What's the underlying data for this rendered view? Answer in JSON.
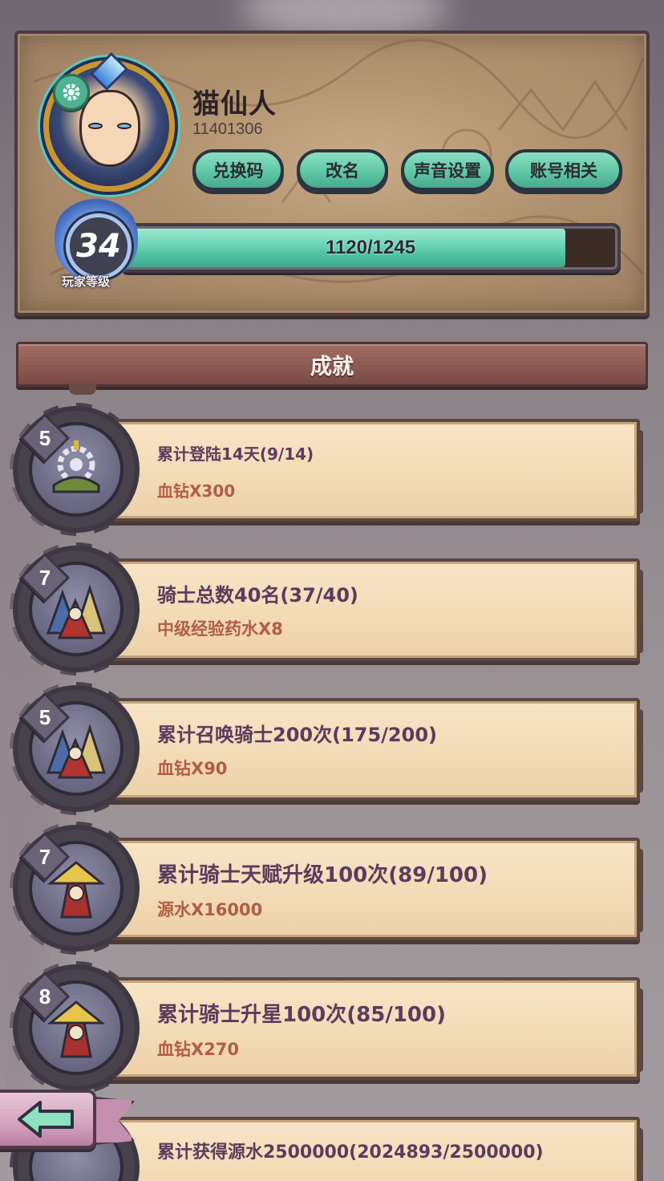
{
  "player": {
    "name": "猫仙人",
    "id": "11401306",
    "level": "34",
    "level_label": "玩家等级",
    "xp_text": "1120/1245",
    "xp_fraction": 0.8996
  },
  "buttons": {
    "redeem": "兑换码",
    "rename": "改名",
    "sound": "声音设置",
    "account": "账号相关"
  },
  "section_title": "成就",
  "achievements": [
    {
      "level": "5",
      "title": "累计登陆14天(9/14)",
      "reward": "血钻X300",
      "icon": "helmet-gear-icon"
    },
    {
      "level": "7",
      "title": "骑士总数40名(37/40)",
      "reward": "中级经验药水X8",
      "icon": "knights-group-icon"
    },
    {
      "level": "5",
      "title": "累计召唤骑士200次(175/200)",
      "reward": "血钻X90",
      "icon": "knights-group-icon"
    },
    {
      "level": "7",
      "title": "累计骑士天赋升级100次(89/100)",
      "reward": "源水X16000",
      "icon": "hooded-knight-icon"
    },
    {
      "level": "8",
      "title": "累计骑士升星100次(85/100)",
      "reward": "血钻X270",
      "icon": "hooded-knight-icon"
    },
    {
      "level": "",
      "title": "累计获得源水2500000(2024893/2500000)",
      "reward": "",
      "icon": "water-icon"
    }
  ],
  "colors": {
    "accent_green": "#5cc5a3",
    "title_purple": "#5b3c5e",
    "reward_red": "#b05d46",
    "banner_red": "#8c5a53"
  }
}
